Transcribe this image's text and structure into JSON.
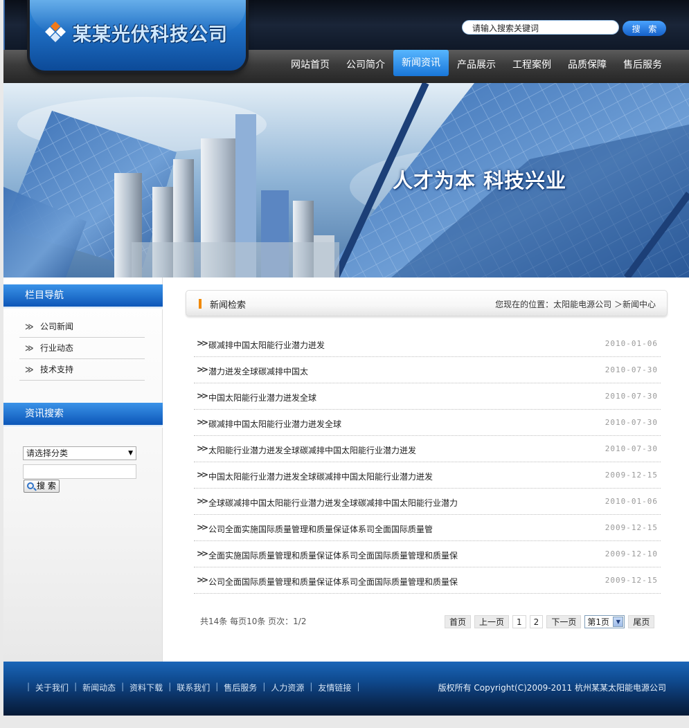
{
  "brand": {
    "logo_text": "某某光伏科技公司",
    "accent": "#1f6fc4"
  },
  "header_search": {
    "value": "请输入搜索关键词",
    "button_label": "搜 索"
  },
  "nav": {
    "items": [
      {
        "label": "网站首页",
        "active": false
      },
      {
        "label": "公司简介",
        "active": false
      },
      {
        "label": "新闻资讯",
        "active": true
      },
      {
        "label": "产品展示",
        "active": false
      },
      {
        "label": "工程案例",
        "active": false
      },
      {
        "label": "品质保障",
        "active": false
      },
      {
        "label": "售后服务",
        "active": false
      }
    ]
  },
  "banner": {
    "slogan": "人才为本 科技兴业"
  },
  "sidebar": {
    "nav_title": "栏目导航",
    "categories": [
      {
        "label": "公司新闻"
      },
      {
        "label": "行业动态"
      },
      {
        "label": "技术支持"
      }
    ],
    "search_title": "资讯搜索",
    "select_value": "请选择分类",
    "keyword_value": "",
    "search_button": "搜 索"
  },
  "main": {
    "title": "新闻检索",
    "breadcrumb": "您现在的位置：太阳能电源公司 ＞新闻中心",
    "news": [
      {
        "title": "碳减排中国太阳能行业潜力迸发",
        "date": "2010-01-06"
      },
      {
        "title": "潜力迸发全球碳减排中国太",
        "date": "2010-07-30"
      },
      {
        "title": "中国太阳能行业潜力迸发全球",
        "date": "2010-07-30"
      },
      {
        "title": "碳减排中国太阳能行业潜力迸发全球",
        "date": "2010-07-30"
      },
      {
        "title": "太阳能行业潜力迸发全球碳减排中国太阳能行业潜力迸发",
        "date": "2010-07-30"
      },
      {
        "title": "中国太阳能行业潜力迸发全球碳减排中国太阳能行业潜力迸发",
        "date": "2009-12-15"
      },
      {
        "title": "全球碳减排中国太阳能行业潜力迸发全球碳减排中国太阳能行业潜力",
        "date": "2010-01-06"
      },
      {
        "title": "公司全面实施国际质量管理和质量保证体系司全面国际质量管",
        "date": "2009-12-15"
      },
      {
        "title": "全面实施国际质量管理和质量保证体系司全面国际质量管理和质量保",
        "date": "2009-12-10"
      },
      {
        "title": "公司全面国际质量管理和质量保证体系司全面国际质量管理和质量保",
        "date": "2009-12-15"
      }
    ],
    "page_info": "共14条  每页10条  页次：1/2",
    "pager": {
      "first": "首页",
      "prev": "上一页",
      "pages": [
        "1",
        "2"
      ],
      "next": "下一页",
      "select": "第1页",
      "last": "尾页"
    }
  },
  "footer": {
    "links": [
      "关于我们",
      "新闻动态",
      "资料下载",
      "联系我们",
      "售后服务",
      "人力资源",
      "友情链接"
    ],
    "copyright": "版权所有  Copyright(C)2009-2011 杭州某某太阳能电源公司"
  }
}
